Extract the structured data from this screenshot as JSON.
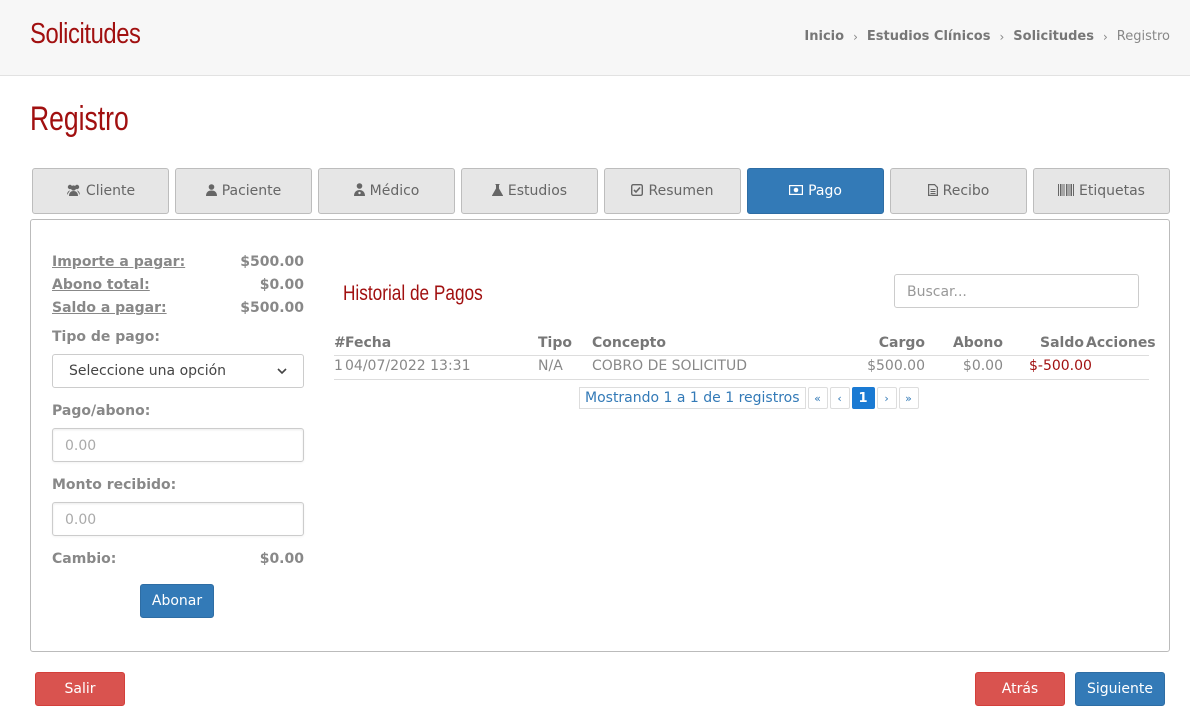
{
  "header": {
    "title": "Solicitudes",
    "breadcrumb": [
      "Inicio",
      "Estudios Clínicos",
      "Solicitudes",
      "Registro"
    ]
  },
  "page_title": "Registro",
  "tabs": [
    {
      "label": "Cliente",
      "icon": "users-icon"
    },
    {
      "label": "Paciente",
      "icon": "user-icon"
    },
    {
      "label": "Médico",
      "icon": "user-md-icon"
    },
    {
      "label": "Estudios",
      "icon": "flask-icon"
    },
    {
      "label": "Resumen",
      "icon": "check-square-icon"
    },
    {
      "label": "Pago",
      "icon": "money-icon"
    },
    {
      "label": "Recibo",
      "icon": "file-text-icon"
    },
    {
      "label": "Etiquetas",
      "icon": "barcode-icon"
    }
  ],
  "active_tab": "Pago",
  "payment": {
    "importe_label": "Importe a pagar:",
    "importe_value": "$500.00",
    "abono_label": "Abono total:",
    "abono_value": "$0.00",
    "saldo_label": "Saldo a pagar:",
    "saldo_value": "$500.00",
    "tipo_label": "Tipo de pago:",
    "tipo_selected": "Seleccione una opción",
    "pago_label": "Pago/abono:",
    "pago_placeholder": "0.00",
    "monto_label": "Monto recibido:",
    "monto_placeholder": "0.00",
    "cambio_label": "Cambio:",
    "cambio_value": "$0.00",
    "abonar_button": "Abonar"
  },
  "history": {
    "title": "Historial de Pagos",
    "search_placeholder": "Buscar...",
    "columns": [
      "#",
      "Fecha",
      "Tipo",
      "Concepto",
      "Cargo",
      "Abono",
      "Saldo",
      "Acciones"
    ],
    "rows": [
      {
        "num": "1",
        "fecha": "04/07/2022 13:31",
        "tipo": "N/A",
        "concepto": "COBRO DE SOLICITUD",
        "cargo": "$500.00",
        "abono": "$0.00",
        "saldo": "$-500.00",
        "acciones": ""
      }
    ],
    "pager_info": "Mostrando 1 a 1 de 1 registros",
    "pager_first": "«",
    "pager_prev": "‹",
    "pager_current": "1",
    "pager_next": "›",
    "pager_last": "»"
  },
  "footer": {
    "salir": "Salir",
    "atras": "Atrás",
    "siguiente": "Siguiente"
  },
  "colors": {
    "brand_red": "#a11010",
    "primary_blue": "#337ab7",
    "danger_red": "#d9534f"
  }
}
